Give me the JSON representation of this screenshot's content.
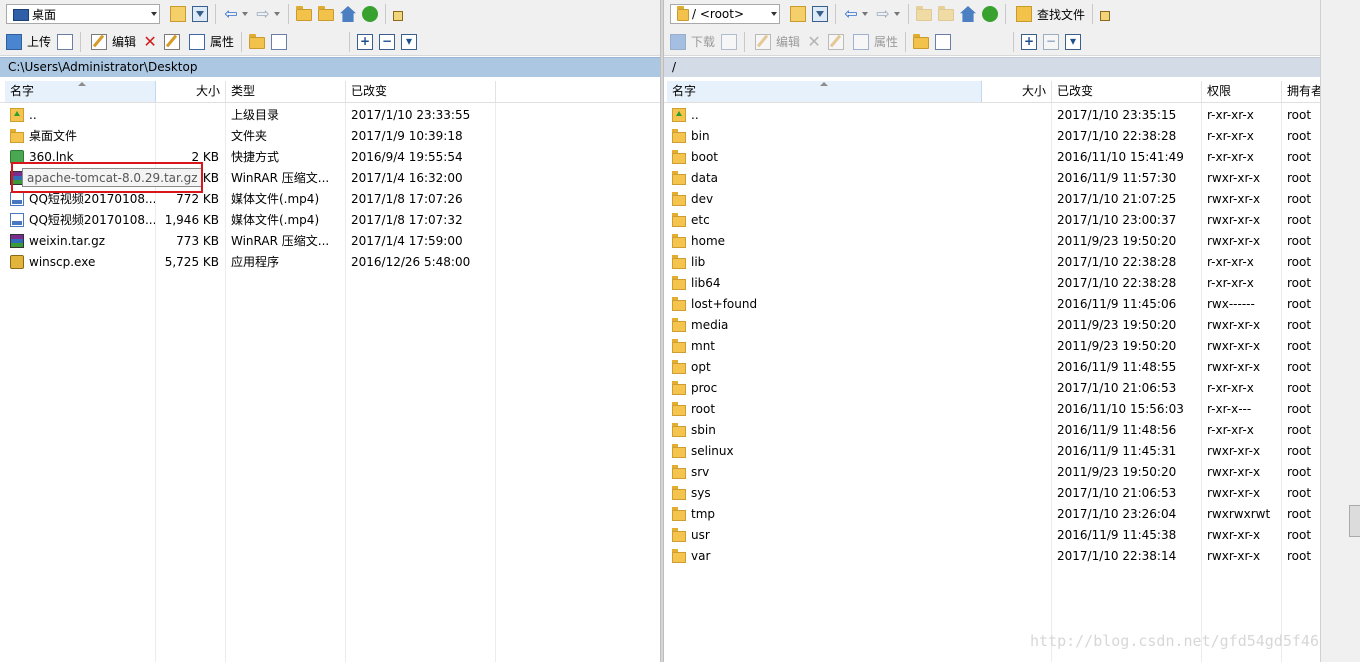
{
  "left": {
    "location": "桌面",
    "toolbar": {
      "upload": "上传",
      "edit": "编辑",
      "properties": "属性"
    },
    "path": "C:\\Users\\Administrator\\Desktop",
    "columns": {
      "name": "名字",
      "size": "大小",
      "type": "类型",
      "modified": "已改变"
    },
    "rows": [
      {
        "icon": "parent-folder-icon",
        "name": "..",
        "size": "",
        "type": "上级目录",
        "modified": "2017/1/10   23:33:55"
      },
      {
        "icon": "folder-icon",
        "name": "桌面文件",
        "size": "",
        "type": "文件夹",
        "modified": "2017/1/9   10:39:18"
      },
      {
        "icon": "shortcut-icon",
        "name": "360.lnk",
        "size": "2 KB",
        "type": "快捷方式",
        "modified": "2016/9/4   19:55:54"
      },
      {
        "icon": "archive-icon",
        "name": "apache-tomcat-8.0.29.tar.gz",
        "size": "KB",
        "type": "WinRAR 压缩文...",
        "modified": "2017/1/4   16:32:00"
      },
      {
        "icon": "video-file-icon",
        "name": "QQ短视频20170108...",
        "size": "772 KB",
        "type": "媒体文件(.mp4)",
        "modified": "2017/1/8   17:07:26"
      },
      {
        "icon": "video-file-icon",
        "name": "QQ短视频20170108...",
        "size": "1,946 KB",
        "type": "媒体文件(.mp4)",
        "modified": "2017/1/8   17:07:32"
      },
      {
        "icon": "archive-icon",
        "name": "weixin.tar.gz",
        "size": "773 KB",
        "type": "WinRAR 压缩文...",
        "modified": "2017/1/4   17:59:00"
      },
      {
        "icon": "exe-icon",
        "name": "winscp.exe",
        "size": "5,725 KB",
        "type": "应用程序",
        "modified": "2016/12/26   5:48:00"
      }
    ],
    "tooltip": "apache-tomcat-8.0.29.tar.gz"
  },
  "right": {
    "location": "/ <root>",
    "toolbar": {
      "find": "查找文件",
      "download": "下载",
      "edit": "编辑",
      "properties": "属性"
    },
    "path": "/",
    "columns": {
      "name": "名字",
      "size": "大小",
      "modified": "已改变",
      "rights": "权限",
      "owner": "拥有者"
    },
    "rows": [
      {
        "icon": "parent-folder-icon",
        "name": "..",
        "modified": "2017/1/10 23:35:15",
        "rights": "r-xr-xr-x",
        "owner": "root"
      },
      {
        "icon": "folder-icon",
        "name": "bin",
        "modified": "2017/1/10 22:38:28",
        "rights": "r-xr-xr-x",
        "owner": "root"
      },
      {
        "icon": "folder-icon",
        "name": "boot",
        "modified": "2016/11/10 15:41:49",
        "rights": "r-xr-xr-x",
        "owner": "root"
      },
      {
        "icon": "folder-icon",
        "name": "data",
        "modified": "2016/11/9 11:57:30",
        "rights": "rwxr-xr-x",
        "owner": "root"
      },
      {
        "icon": "folder-icon",
        "name": "dev",
        "modified": "2017/1/10 21:07:25",
        "rights": "rwxr-xr-x",
        "owner": "root"
      },
      {
        "icon": "folder-icon",
        "name": "etc",
        "modified": "2017/1/10 23:00:37",
        "rights": "rwxr-xr-x",
        "owner": "root"
      },
      {
        "icon": "folder-icon",
        "name": "home",
        "modified": "2011/9/23 19:50:20",
        "rights": "rwxr-xr-x",
        "owner": "root"
      },
      {
        "icon": "folder-icon",
        "name": "lib",
        "modified": "2017/1/10 22:38:28",
        "rights": "r-xr-xr-x",
        "owner": "root"
      },
      {
        "icon": "folder-icon",
        "name": "lib64",
        "modified": "2017/1/10 22:38:28",
        "rights": "r-xr-xr-x",
        "owner": "root"
      },
      {
        "icon": "folder-icon",
        "name": "lost+found",
        "modified": "2016/11/9 11:45:06",
        "rights": "rwx------",
        "owner": "root"
      },
      {
        "icon": "folder-icon",
        "name": "media",
        "modified": "2011/9/23 19:50:20",
        "rights": "rwxr-xr-x",
        "owner": "root"
      },
      {
        "icon": "folder-icon",
        "name": "mnt",
        "modified": "2011/9/23 19:50:20",
        "rights": "rwxr-xr-x",
        "owner": "root"
      },
      {
        "icon": "folder-icon",
        "name": "opt",
        "modified": "2016/11/9 11:48:55",
        "rights": "rwxr-xr-x",
        "owner": "root"
      },
      {
        "icon": "folder-icon",
        "name": "proc",
        "modified": "2017/1/10 21:06:53",
        "rights": "r-xr-xr-x",
        "owner": "root"
      },
      {
        "icon": "folder-icon",
        "name": "root",
        "modified": "2016/11/10 15:56:03",
        "rights": "r-xr-x---",
        "owner": "root"
      },
      {
        "icon": "folder-icon",
        "name": "sbin",
        "modified": "2016/11/9 11:48:56",
        "rights": "r-xr-xr-x",
        "owner": "root"
      },
      {
        "icon": "folder-icon",
        "name": "selinux",
        "modified": "2016/11/9 11:45:31",
        "rights": "rwxr-xr-x",
        "owner": "root"
      },
      {
        "icon": "folder-icon",
        "name": "srv",
        "modified": "2011/9/23 19:50:20",
        "rights": "rwxr-xr-x",
        "owner": "root"
      },
      {
        "icon": "folder-icon",
        "name": "sys",
        "modified": "2017/1/10 21:06:53",
        "rights": "rwxr-xr-x",
        "owner": "root"
      },
      {
        "icon": "folder-icon",
        "name": "tmp",
        "modified": "2017/1/10 23:26:04",
        "rights": "rwxrwxrwt",
        "owner": "root"
      },
      {
        "icon": "folder-icon",
        "name": "usr",
        "modified": "2016/11/9 11:45:38",
        "rights": "rwxr-xr-x",
        "owner": "root"
      },
      {
        "icon": "folder-icon",
        "name": "var",
        "modified": "2017/1/10 22:38:14",
        "rights": "rwxr-xr-x",
        "owner": "root"
      }
    ]
  },
  "watermark": "http://blog.csdn.net/gfd54gd5f46",
  "colors": {
    "highlight_box": "#d9161c",
    "left_path_bar": "#abc7e2",
    "right_path_bar": "#d2dbe6"
  }
}
